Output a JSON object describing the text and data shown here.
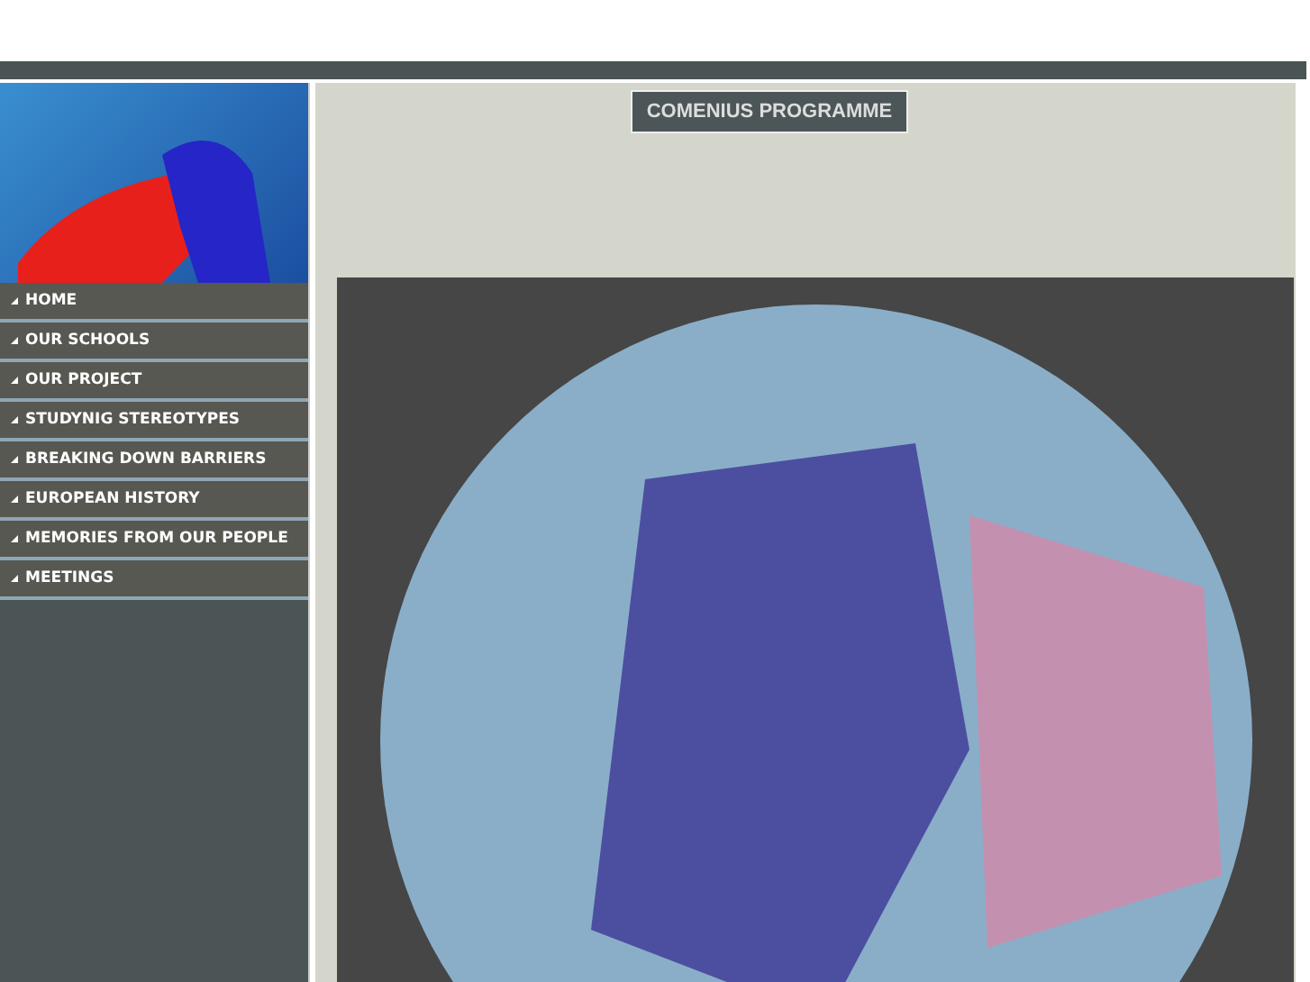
{
  "header": {
    "title": "COMENIUS PROGRAMME"
  },
  "sidebar": {
    "items": [
      {
        "label": "HOME"
      },
      {
        "label": "OUR SCHOOLS"
      },
      {
        "label": "OUR PROJECT"
      },
      {
        "label": "STUDYNIG STEREOTYPES"
      },
      {
        "label": "BREAKING DOWN BARRIERS"
      },
      {
        "label": "EUROPEAN HISTORY"
      },
      {
        "label": "MEMORIES FROM OUR PEOPLE"
      },
      {
        "label": "MEETINGS"
      }
    ]
  }
}
